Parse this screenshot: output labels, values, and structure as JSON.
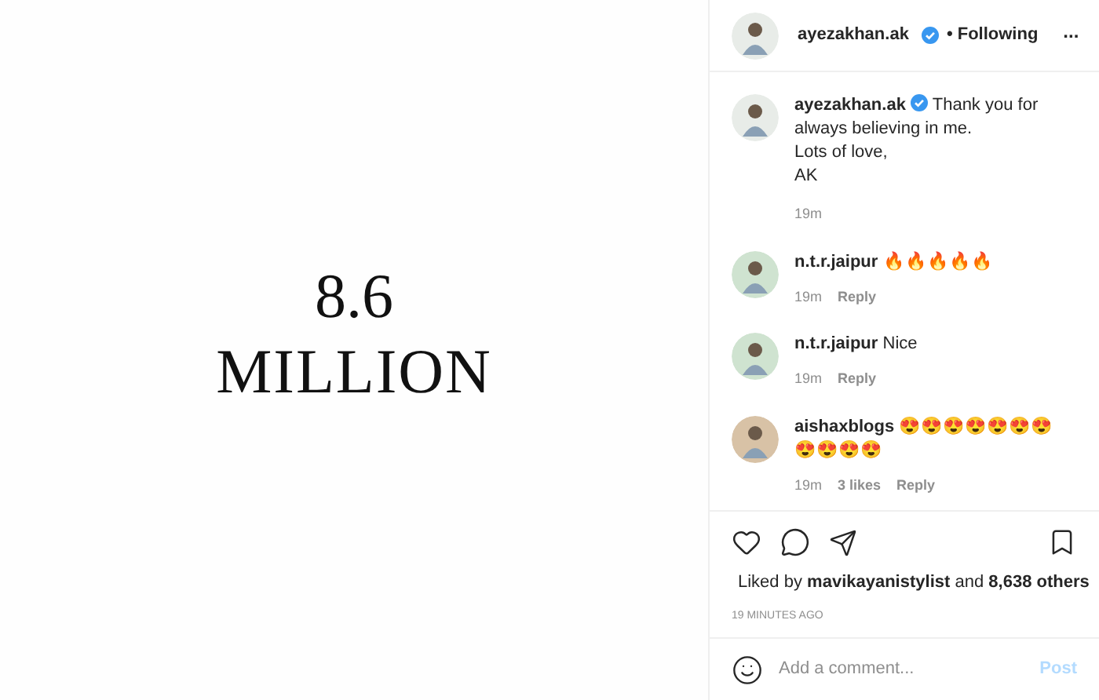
{
  "post_image": {
    "line_1": "8.6",
    "line_2": "MILLION"
  },
  "header": {
    "username": "ayezakhan.ak",
    "verified": true,
    "follow_status": "• Following",
    "more": "..."
  },
  "caption": {
    "username": "ayezakhan.ak",
    "verified": true,
    "lines": [
      "Thank you for always believing in me.",
      "Lots of love,",
      "AK"
    ],
    "time": "19m"
  },
  "comments": [
    {
      "username": "n.t.r.jaipur",
      "text": "🔥🔥🔥🔥🔥",
      "time": "19m",
      "reply": "Reply"
    },
    {
      "username": "n.t.r.jaipur",
      "text": "Nice",
      "time": "19m",
      "reply": "Reply"
    },
    {
      "username": "aishaxblogs",
      "text": "😍😍😍😍😍😍😍😍😍😍😍",
      "time": "19m",
      "likes": "3 likes",
      "reply": "Reply"
    }
  ],
  "likes": {
    "liked_by": "Liked by",
    "user": "mavikayanistylist",
    "and": "and",
    "others": "8,638 others"
  },
  "timestamp": "19 MINUTES AGO",
  "comment_box": {
    "placeholder": "Add a comment...",
    "post": "Post"
  }
}
